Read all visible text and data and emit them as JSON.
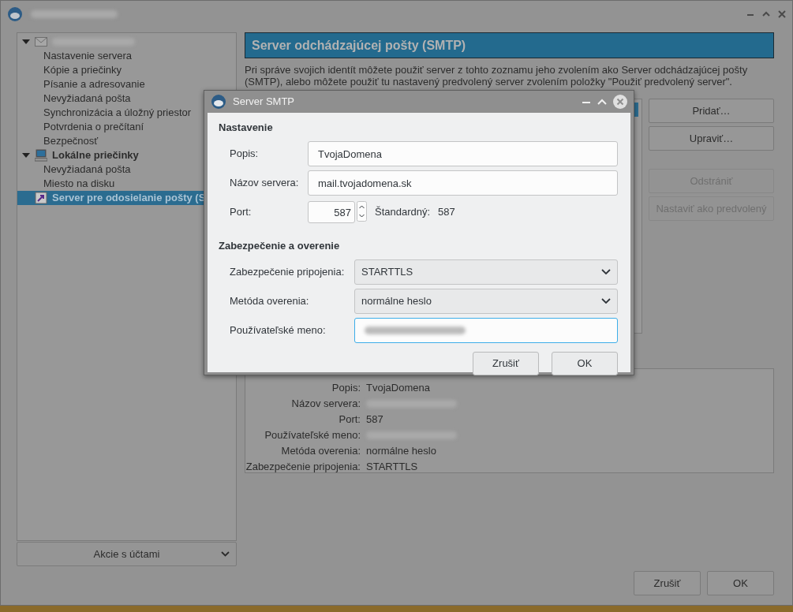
{
  "tree": [
    {
      "kind": "account",
      "expanded": true,
      "bold": false,
      "selected": false,
      "children": [
        {
          "label": "Nastavenie servera",
          "selected": false
        },
        {
          "label": "Kópie a priečinky",
          "selected": false
        },
        {
          "label": "Písanie a adresovanie",
          "selected": false
        },
        {
          "label": "Nevyžiadaná pošta",
          "selected": false
        },
        {
          "label": "Synchronizácia a úložný priestor",
          "selected": false
        },
        {
          "label": "Potvrdenia o prečítaní",
          "selected": false
        },
        {
          "label": "Bezpečnosť",
          "selected": false
        }
      ]
    },
    {
      "kind": "local",
      "label": "Lokálne priečinky",
      "expanded": true,
      "bold": true,
      "selected": false,
      "children": [
        {
          "label": "Nevyžiadaná pošta",
          "selected": false
        },
        {
          "label": "Miesto na disku",
          "selected": false
        }
      ]
    },
    {
      "kind": "outgoing",
      "label": "Server pre odosielanie pošty (S",
      "bold": true,
      "selected": true
    }
  ],
  "account_actions": "Akcie s účtami",
  "header": "Server odchádzajúcej pošty (SMTP)",
  "description": "Pri správe svojich identít môžete použiť server z tohto zoznamu jeho zvolením ako Server odchádzajúcej pošty (SMTP), alebo môžete použiť tu nastavený predvolený server zvolením položky \"Použiť predvolený server\".",
  "side_buttons": [
    {
      "label": "Pridať…",
      "disabled": false
    },
    {
      "label": "Upraviť…",
      "disabled": false
    },
    {
      "label": "Odstrániť",
      "disabled": true
    },
    {
      "label": "Nastaviť ako predvolený",
      "disabled": true
    }
  ],
  "details": [
    {
      "label": "Popis:",
      "value": "TvojaDomena"
    },
    {
      "label": "Názov servera:"
    },
    {
      "label": "Port:",
      "value": "587"
    },
    {
      "label": "Používateľské meno:"
    },
    {
      "label": "Metóda overenia:",
      "value": "normálne heslo"
    },
    {
      "label": "Zabezpečenie pripojenia:",
      "value": "STARTTLS"
    }
  ],
  "footer_buttons": [
    "Zrušiť",
    "OK"
  ],
  "dialog": {
    "title": "Server SMTP",
    "sections": [
      {
        "heading": "Nastavenie",
        "fields": [
          {
            "kind": "text",
            "label": "Popis:",
            "value": "TvojaDomena",
            "focused": false
          },
          {
            "kind": "text",
            "label": "Názov servera:",
            "value": "mail.tvojadomena.sk",
            "focused": false
          },
          {
            "kind": "spin",
            "label": "Port:",
            "value": "587",
            "note": "Štandardný:",
            "note_value": "587"
          }
        ]
      },
      {
        "heading": "Zabezpečenie a overenie",
        "fields": [
          {
            "kind": "select",
            "label": "Zabezpečenie pripojenia:",
            "value": "STARTTLS"
          },
          {
            "kind": "select",
            "label": "Metóda overenia:",
            "value": "normálne heslo"
          },
          {
            "kind": "text",
            "label": "Používateľské meno:",
            "focused": true
          }
        ]
      }
    ],
    "buttons": [
      "Zrušiť",
      "OK"
    ]
  }
}
